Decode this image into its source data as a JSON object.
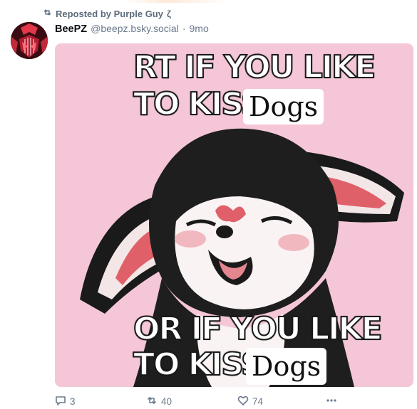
{
  "repost": {
    "label": "Reposted by Purple Guy",
    "suffix_glyph": "ζ"
  },
  "post": {
    "author_name": "BeePZ",
    "handle": "@beepz.bsky.social",
    "separator": "·",
    "timestamp": "9mo",
    "image": {
      "line1": "RT IF YOU LIKE",
      "line2": "TO KISS",
      "line2_word": "Dogs",
      "line3": "OR IF YOU LIKE",
      "line4": "TO KISS",
      "line4_word": "Dogs"
    }
  },
  "actions": {
    "reply_count": "3",
    "repost_count": "40",
    "like_count": "74",
    "icons": [
      "reply-icon",
      "repost-icon",
      "like-icon",
      "more-icon"
    ]
  },
  "colors": {
    "image_bg": "#f4c6d8",
    "muted": "#6b7a8c",
    "repost_text": "#5b6b7c"
  }
}
